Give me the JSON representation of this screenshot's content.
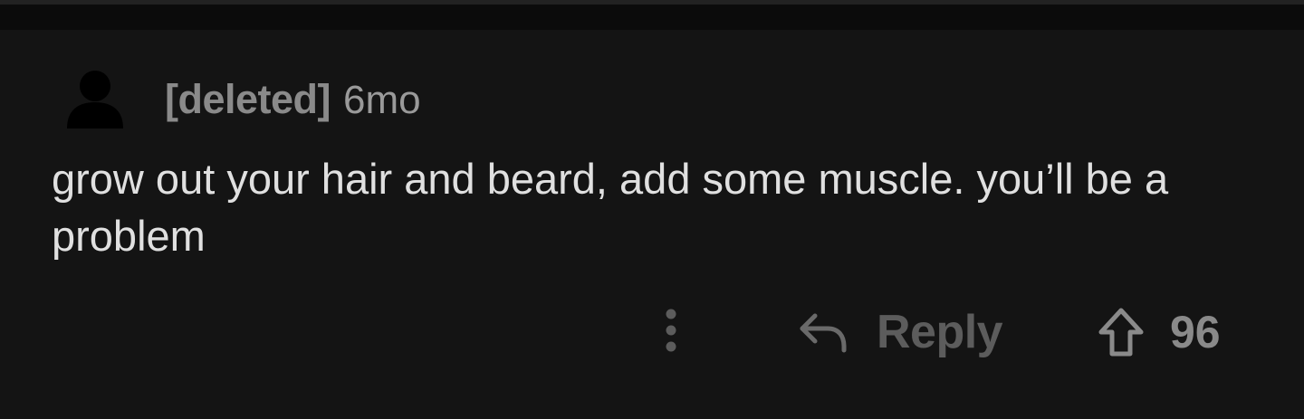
{
  "comment": {
    "author": "[deleted]",
    "age": "6mo",
    "body": "grow out your hair and beard, add some muscle. you’ll be a problem"
  },
  "actions": {
    "more_icon": "more-vertical-icon",
    "reply_icon": "reply-arrow-icon",
    "reply_label": "Reply",
    "upvote_icon": "upvote-arrow-icon",
    "score": "96"
  },
  "colors": {
    "background": "#141414",
    "text": "#e0e0e0",
    "muted": "#8a8a8a",
    "dim": "#5c5c5c"
  }
}
